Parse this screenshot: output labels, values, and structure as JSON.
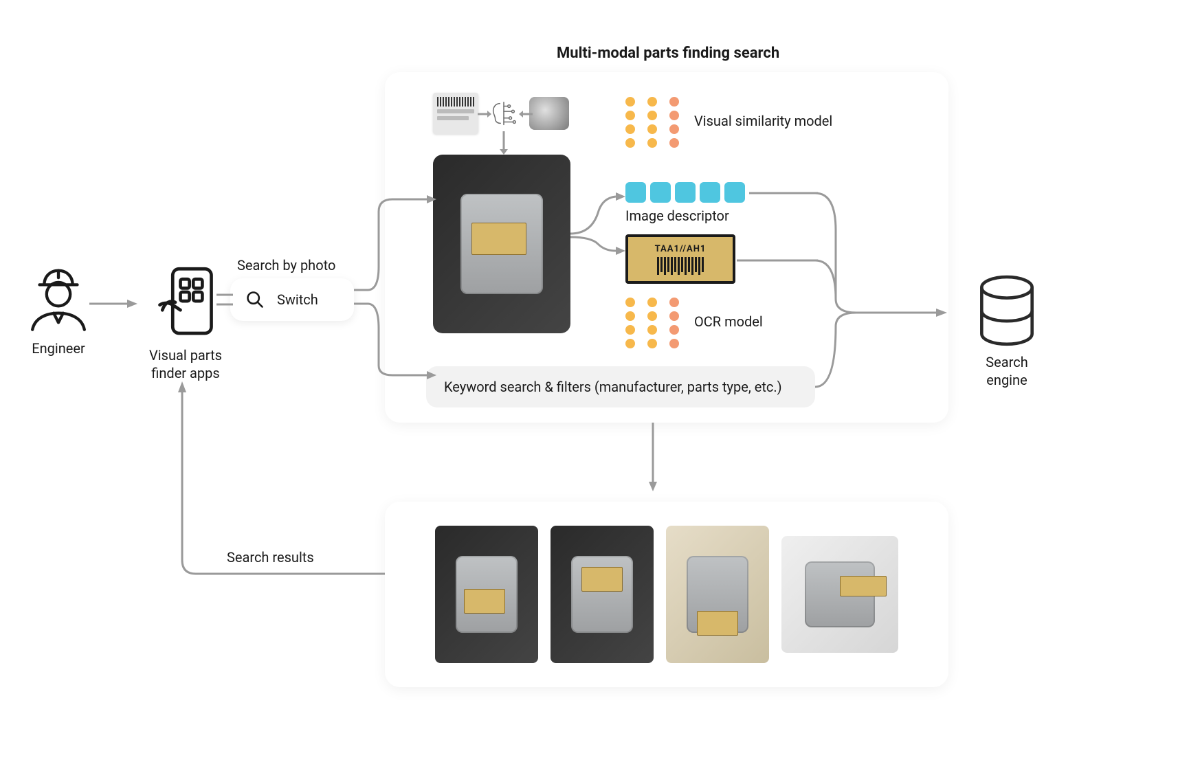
{
  "nodes": {
    "engineer": "Engineer",
    "apps": "Visual parts\nfinder apps",
    "search_by_photo": "Search by photo",
    "search_term": "Switch",
    "search_results": "Search results",
    "search_engine": "Search\nengine"
  },
  "multimodal": {
    "title": "Multi-modal parts finding search",
    "visual_similarity": "Visual similarity model",
    "image_descriptor": "Image descriptor",
    "ocr_model": "OCR model",
    "keyword_bar": "Keyword search & filters (manufacturer, parts type, etc.)",
    "barcode_text": "TAA1//AH1"
  }
}
